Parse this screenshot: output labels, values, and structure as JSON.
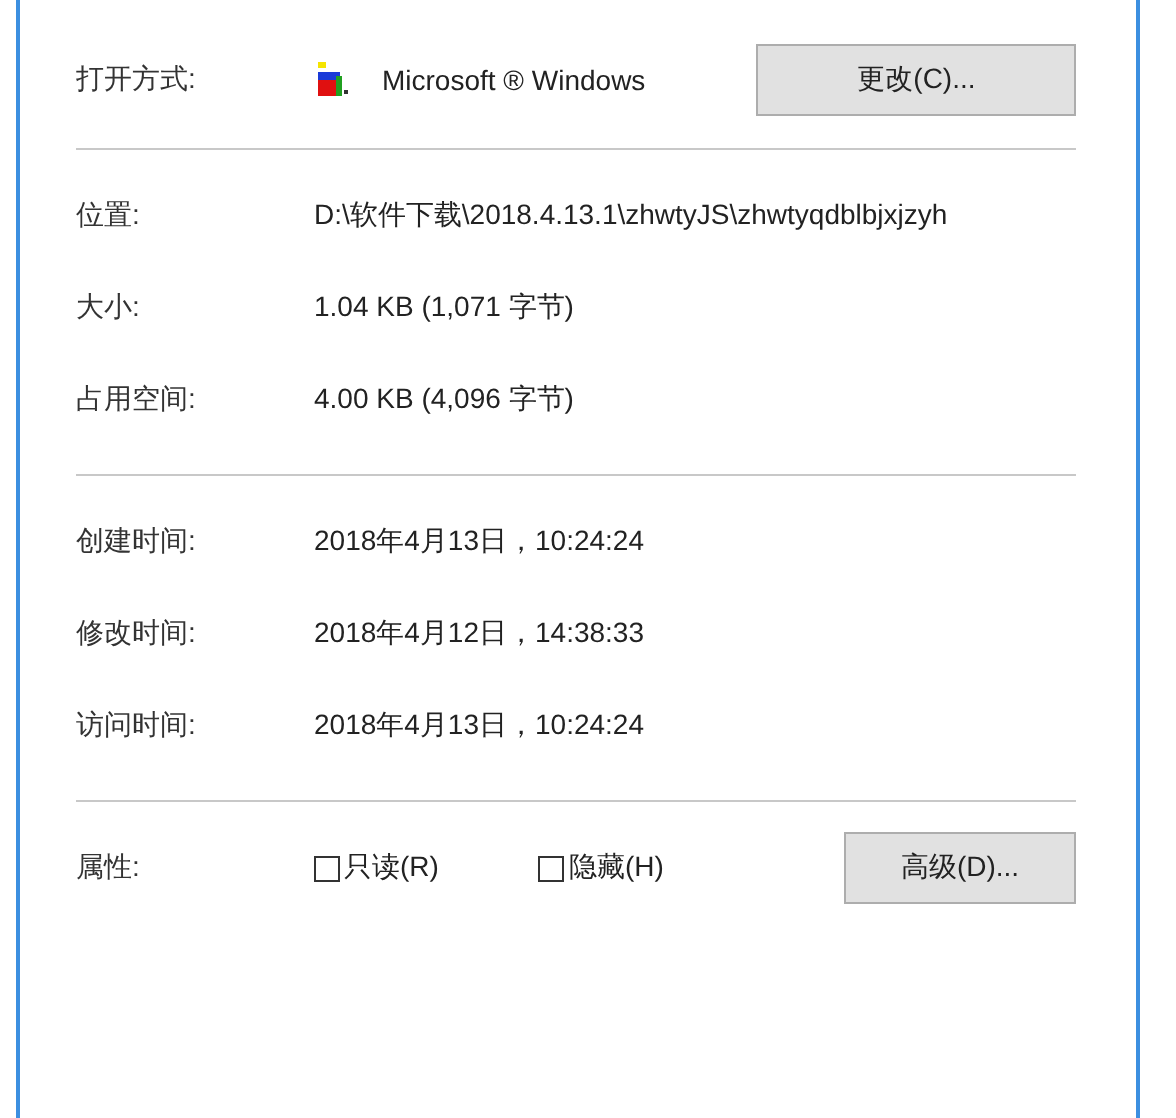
{
  "open_with": {
    "label": "打开方式:",
    "app": "Microsoft ® Windows",
    "button": "更改(C)..."
  },
  "location_group": [
    {
      "label": "位置:",
      "value": "D:\\软件下载\\2018.4.13.1\\zhwtyJS\\zhwtyqdblbjxjzyh"
    },
    {
      "label": "大小:",
      "value": "1.04 KB (1,071 字节)"
    },
    {
      "label": "占用空间:",
      "value": "4.00 KB (4,096 字节)"
    }
  ],
  "time_group": [
    {
      "label": "创建时间:",
      "value": "2018年4月13日，10:24:24"
    },
    {
      "label": "修改时间:",
      "value": "2018年4月12日，14:38:33"
    },
    {
      "label": "访问时间:",
      "value": "2018年4月13日，10:24:24"
    }
  ],
  "attributes": {
    "label": "属性:",
    "checkboxes": [
      {
        "label": "只读(R)",
        "checked": false
      },
      {
        "label": "隐藏(H)",
        "checked": false
      }
    ],
    "button": "高级(D)..."
  }
}
